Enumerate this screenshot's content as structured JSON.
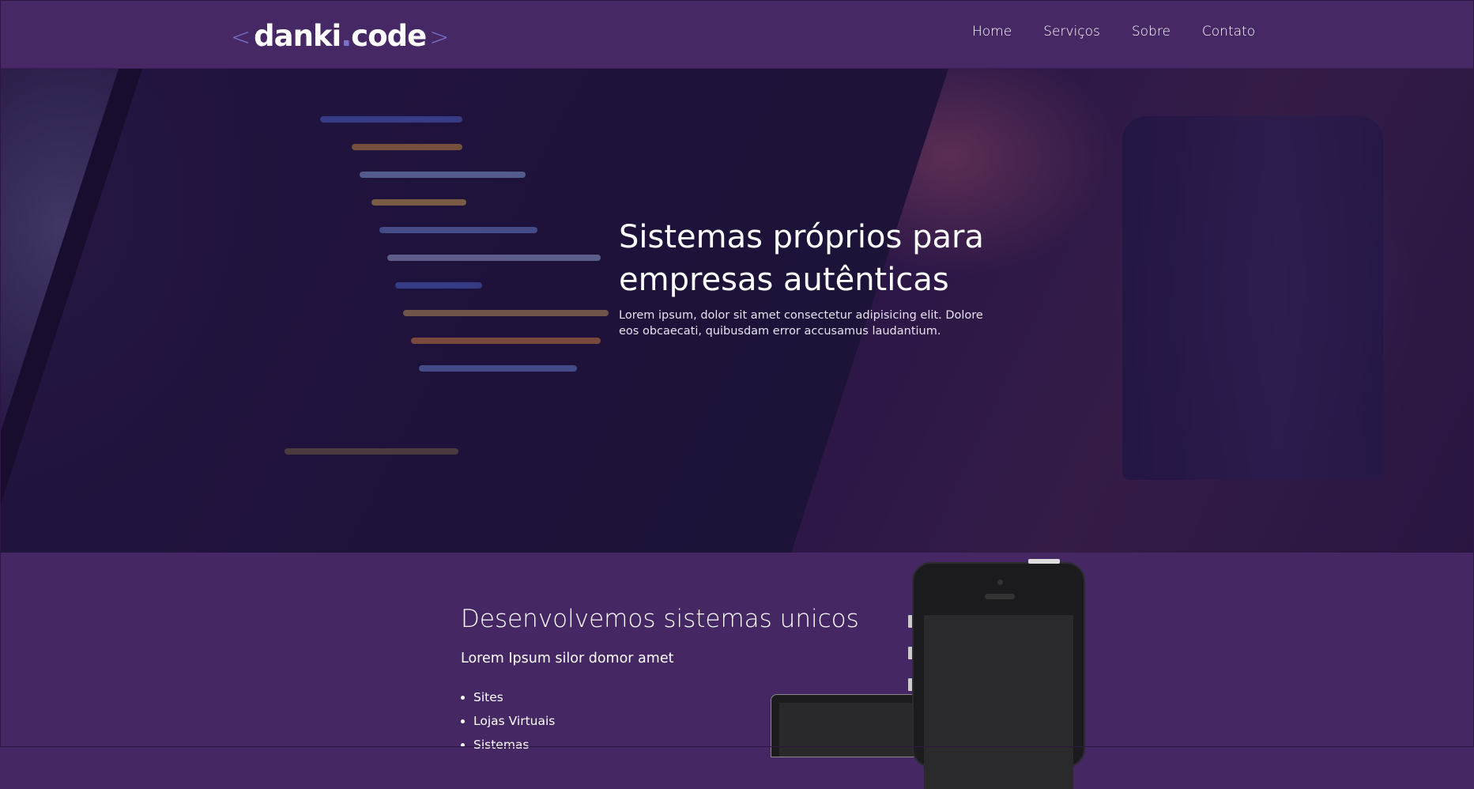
{
  "header": {
    "logo": {
      "bracket_left": "<",
      "word1": "danki",
      "dot": ".",
      "word2": "code",
      "bracket_right": ">"
    },
    "nav": [
      {
        "label": "Home"
      },
      {
        "label": "Serviços"
      },
      {
        "label": "Sobre"
      },
      {
        "label": "Contato"
      }
    ]
  },
  "hero": {
    "title": "Sistemas próprios para empresas autênticas",
    "description": "Lorem ipsum, dolor sit amet consectetur adipisicing elit. Dolore eos obcaecati, quibusdam error accusamus laudantium."
  },
  "services": {
    "title": "Desenvolvemos sistemas unicos",
    "subtitle": "Lorem Ipsum silor domor amet",
    "items": [
      "Sites",
      "Lojas Virtuais",
      "Sistemas"
    ]
  },
  "colors": {
    "brand_purple": "#452764",
    "logo_accent": "#7a72c9"
  }
}
